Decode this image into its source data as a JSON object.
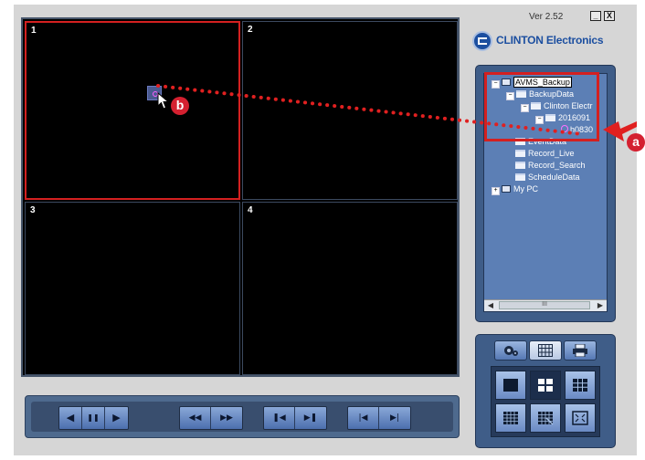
{
  "app": {
    "version": "Ver 2.52",
    "brand": "CLINTON Electronics",
    "window_buttons": [
      "_",
      "X"
    ]
  },
  "video_grid": {
    "cells": [
      {
        "number": "1",
        "selected": true
      },
      {
        "number": "2",
        "selected": false
      },
      {
        "number": "3",
        "selected": false
      },
      {
        "number": "4",
        "selected": false
      }
    ]
  },
  "tree": {
    "nodes": [
      {
        "label": "AVMS_Backup",
        "selected": true
      },
      {
        "label": "BackupData"
      },
      {
        "label": "Clinton Electr"
      },
      {
        "label": "2016091"
      },
      {
        "label": "h0830"
      },
      {
        "label": "EventData"
      },
      {
        "label": "Record_Live"
      },
      {
        "label": "Record_Search"
      },
      {
        "label": "ScheduleData"
      },
      {
        "label": "My PC"
      }
    ],
    "scrollbar_thumb": "III"
  },
  "annotations": {
    "a": "a",
    "b": "b"
  },
  "playback": {
    "buttons": [
      {
        "name": "reverse-play",
        "glyph": "◀"
      },
      {
        "name": "pause",
        "glyph": "❚❚"
      },
      {
        "name": "play",
        "glyph": "▶"
      },
      {
        "name": "fast-reverse",
        "glyph": "◀◀"
      },
      {
        "name": "fast-forward",
        "glyph": "▶▶"
      },
      {
        "name": "step-back",
        "glyph": "❚◀"
      },
      {
        "name": "step-forward",
        "glyph": "▶❚"
      },
      {
        "name": "skip-start",
        "glyph": "|◀"
      },
      {
        "name": "skip-end",
        "glyph": "▶|"
      }
    ]
  },
  "tabs": [
    {
      "name": "settings",
      "icon": "gear-icon"
    },
    {
      "name": "layout",
      "icon": "grid-icon",
      "active": true
    },
    {
      "name": "print",
      "icon": "printer-icon"
    }
  ],
  "layouts": [
    {
      "name": "layout-1",
      "active": false
    },
    {
      "name": "layout-4",
      "active": true
    },
    {
      "name": "layout-9",
      "active": false
    },
    {
      "name": "layout-16",
      "active": false
    },
    {
      "name": "layout-custom",
      "active": false
    },
    {
      "name": "layout-fullscreen",
      "active": false
    }
  ],
  "colors": {
    "highlight_red": "#d42020",
    "panel_blue": "#3f5d88",
    "brand_blue": "#1c4fa0"
  }
}
